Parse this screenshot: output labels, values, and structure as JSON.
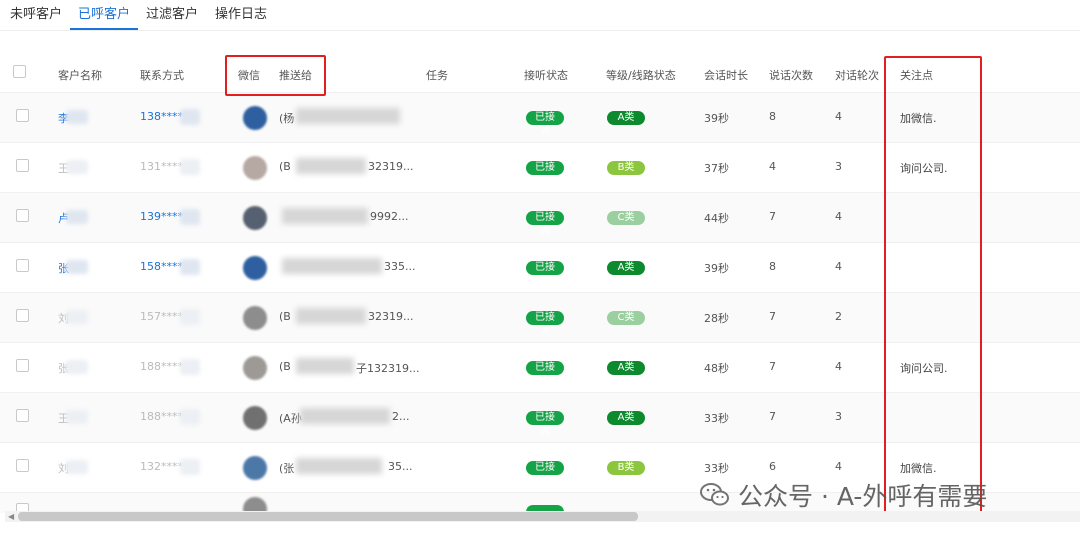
{
  "tabs": [
    "未呼客户",
    "已呼客户",
    "过滤客户",
    "操作日志"
  ],
  "active_tab": "已呼客户",
  "columns": {
    "name": "客户名称",
    "phone": "联系方式",
    "wechat": "微信",
    "push": "推送给",
    "task": "任务",
    "answer": "接听状态",
    "grade": "等级/线路状态",
    "duration": "会话时长",
    "talks": "说话次数",
    "turns": "对话轮次",
    "focus": "关注点"
  },
  "rows": [
    {
      "name": "李",
      "phone": "138****",
      "push": "(杨",
      "push_tail": "",
      "status": "已接通",
      "grade": "A类",
      "duration": "39秒",
      "talks": "8",
      "turns": "4",
      "focus": "加微信."
    },
    {
      "name": "王",
      "phone": "131****",
      "push": "(B",
      "push_tail": "32319...",
      "status": "已接通",
      "grade": "B类",
      "duration": "37秒",
      "talks": "4",
      "turns": "3",
      "focus": "询问公司."
    },
    {
      "name": "卢",
      "phone": "139****",
      "push": "",
      "push_tail": "9992...",
      "status": "已接通",
      "grade": "C类",
      "duration": "44秒",
      "talks": "7",
      "turns": "4",
      "focus": ""
    },
    {
      "name": "张",
      "phone": "158****",
      "push": "",
      "push_tail": "335...",
      "status": "已接通",
      "grade": "A类",
      "duration": "39秒",
      "talks": "8",
      "turns": "4",
      "focus": ""
    },
    {
      "name": "刘",
      "phone": "157****",
      "push": "(B",
      "push_tail": "32319...",
      "status": "已接通",
      "grade": "C类",
      "duration": "28秒",
      "talks": "7",
      "turns": "2",
      "focus": ""
    },
    {
      "name": "张",
      "phone": "188****",
      "push": "(B",
      "push_tail": "子132319...",
      "status": "已接通",
      "grade": "A类",
      "duration": "48秒",
      "talks": "7",
      "turns": "4",
      "focus": "询问公司."
    },
    {
      "name": "王",
      "phone": "188****",
      "push": "(A孙",
      "push_tail": "2...",
      "status": "已接通",
      "grade": "A类",
      "duration": "33秒",
      "talks": "7",
      "turns": "3",
      "focus": ""
    },
    {
      "name": "刘",
      "phone": "132****",
      "push": "(张",
      "push_tail": "35...",
      "status": "已接通",
      "grade": "B类",
      "duration": "33秒",
      "talks": "6",
      "turns": "4",
      "focus": "加微信."
    }
  ],
  "watermark": "公众号 · A-外呼有需要",
  "colors": {
    "accent": "#1a73d8",
    "highlight_box": "#e02020",
    "answered": "#14a346"
  }
}
